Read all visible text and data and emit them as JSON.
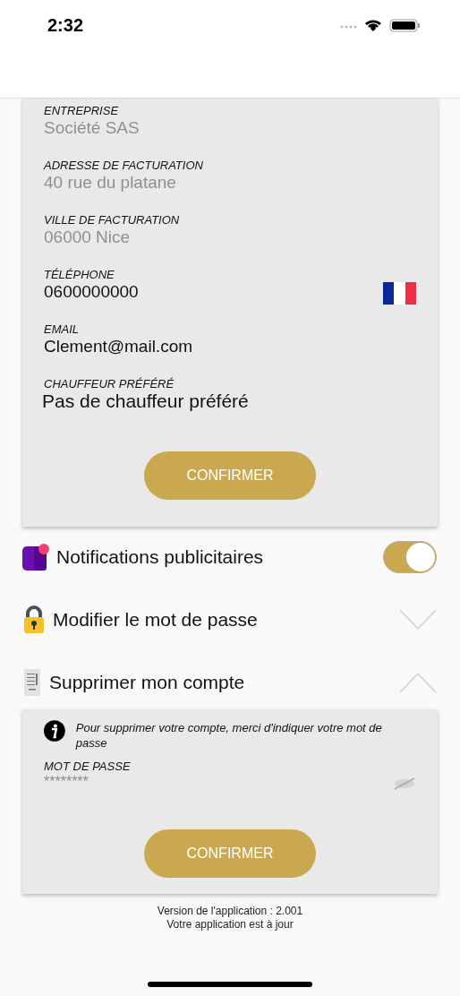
{
  "status_bar": {
    "time": "2:32"
  },
  "profile_form": {
    "fields": [
      {
        "label": "ENTREPRISE",
        "value": "Société SAS",
        "disabled": true,
        "kind": "text"
      },
      {
        "label": "ADRESSE DE FACTURATION",
        "value": "40 rue du platane",
        "disabled": true,
        "kind": "text"
      },
      {
        "label": "VILLE DE FACTURATION",
        "value": "06000 Nice",
        "disabled": true,
        "kind": "text"
      },
      {
        "label": "TÉLÉPHONE",
        "value": "0600000000",
        "disabled": false,
        "kind": "phone"
      },
      {
        "label": "EMAIL",
        "value": "Clement@mail.com",
        "disabled": false,
        "kind": "text"
      },
      {
        "label": "CHAUFFEUR PRÉFÉRÉ",
        "value": "Pas de chauffeur préféré",
        "disabled": false,
        "kind": "select"
      }
    ],
    "button": "CONFIRMER"
  },
  "settings": [
    {
      "kind": "toggle",
      "label": "Notifications publicitaires",
      "on": true
    },
    {
      "kind": "expandable",
      "label": "Modifier le mot de passe",
      "expanded": false
    },
    {
      "kind": "expandable",
      "label": "Supprimer mon compte",
      "expanded": true
    }
  ],
  "delete_panel": {
    "info": "Pour supprimer votre compte, merci d'indiquer votre mot de passe",
    "password_label": "MOT DE PASSE",
    "password_placeholder": "********",
    "button": "CONFIRMER"
  },
  "footer": {
    "version": "Version de l'application : 2.001",
    "status": "Votre application est à jour"
  }
}
